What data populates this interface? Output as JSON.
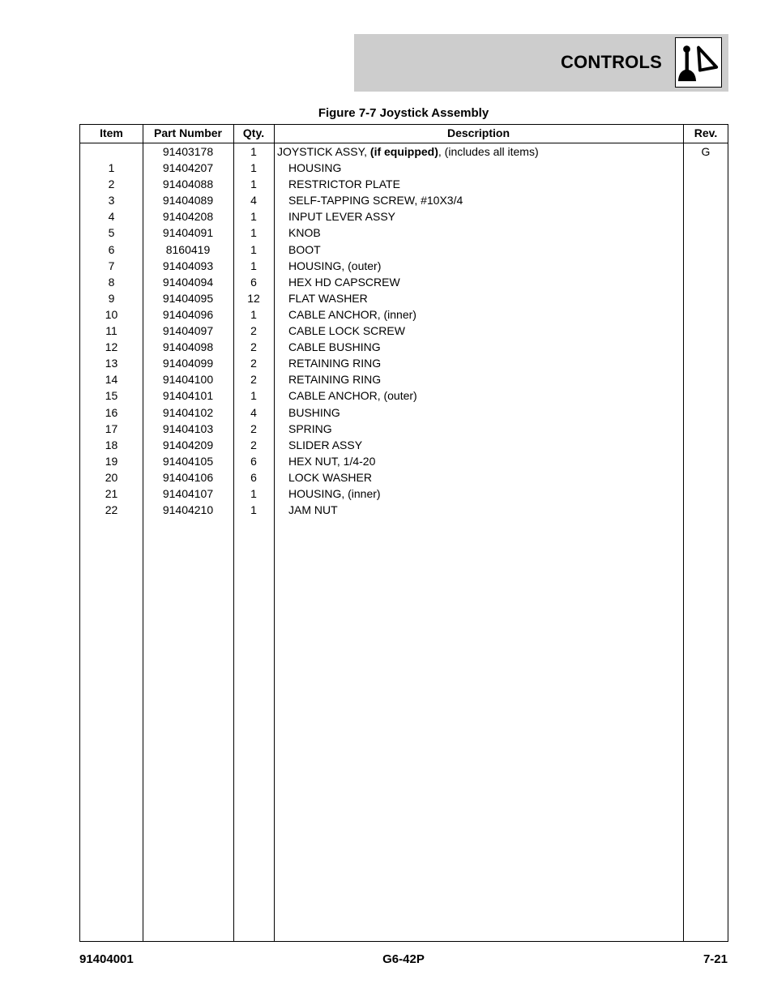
{
  "header": {
    "section_title": "CONTROLS",
    "icon": "joystick-controls-icon",
    "band_color": "#cdcdcd"
  },
  "figure_title": "Figure 7-7 Joystick Assembly",
  "table": {
    "columns": {
      "item": "Item",
      "part_number": "Part Number",
      "qty": "Qty.",
      "description": "Description",
      "rev": "Rev."
    },
    "rows": [
      {
        "item": "",
        "part_number": "91403178",
        "qty": "1",
        "description_prefix": "JOYSTICK ASSY, ",
        "description_bold": "(if equipped)",
        "description_suffix": ", (includes all items)",
        "rev": "G"
      },
      {
        "item": "1",
        "part_number": "91404207",
        "qty": "1",
        "description": "HOUSING",
        "rev": ""
      },
      {
        "item": "2",
        "part_number": "91404088",
        "qty": "1",
        "description": "RESTRICTOR PLATE",
        "rev": ""
      },
      {
        "item": "3",
        "part_number": "91404089",
        "qty": "4",
        "description": "SELF-TAPPING SCREW, #10X3/4",
        "rev": ""
      },
      {
        "item": "4",
        "part_number": "91404208",
        "qty": "1",
        "description": "INPUT LEVER ASSY",
        "rev": ""
      },
      {
        "item": "5",
        "part_number": "91404091",
        "qty": "1",
        "description": "KNOB",
        "rev": ""
      },
      {
        "item": "6",
        "part_number": "8160419",
        "qty": "1",
        "description": "BOOT",
        "rev": ""
      },
      {
        "item": "7",
        "part_number": "91404093",
        "qty": "1",
        "description": "HOUSING, (outer)",
        "rev": ""
      },
      {
        "item": "8",
        "part_number": "91404094",
        "qty": "6",
        "description": "HEX HD CAPSCREW",
        "rev": ""
      },
      {
        "item": "9",
        "part_number": "91404095",
        "qty": "12",
        "description": "FLAT WASHER",
        "rev": ""
      },
      {
        "item": "10",
        "part_number": "91404096",
        "qty": "1",
        "description": "CABLE ANCHOR, (inner)",
        "rev": ""
      },
      {
        "item": "11",
        "part_number": "91404097",
        "qty": "2",
        "description": "CABLE LOCK SCREW",
        "rev": ""
      },
      {
        "item": "12",
        "part_number": "91404098",
        "qty": "2",
        "description": "CABLE BUSHING",
        "rev": ""
      },
      {
        "item": "13",
        "part_number": "91404099",
        "qty": "2",
        "description": "RETAINING RING",
        "rev": ""
      },
      {
        "item": "14",
        "part_number": "91404100",
        "qty": "2",
        "description": "RETAINING RING",
        "rev": ""
      },
      {
        "item": "15",
        "part_number": "91404101",
        "qty": "1",
        "description": "CABLE ANCHOR, (outer)",
        "rev": ""
      },
      {
        "item": "16",
        "part_number": "91404102",
        "qty": "4",
        "description": "BUSHING",
        "rev": ""
      },
      {
        "item": "17",
        "part_number": "91404103",
        "qty": "2",
        "description": "SPRING",
        "rev": ""
      },
      {
        "item": "18",
        "part_number": "91404209",
        "qty": "2",
        "description": "SLIDER ASSY",
        "rev": ""
      },
      {
        "item": "19",
        "part_number": "91404105",
        "qty": "6",
        "description": "HEX NUT, 1/4-20",
        "rev": ""
      },
      {
        "item": "20",
        "part_number": "91404106",
        "qty": "6",
        "description": "LOCK WASHER",
        "rev": ""
      },
      {
        "item": "21",
        "part_number": "91404107",
        "qty": "1",
        "description": "HOUSING, (inner)",
        "rev": ""
      },
      {
        "item": "22",
        "part_number": "91404210",
        "qty": "1",
        "description": "JAM NUT",
        "rev": ""
      }
    ]
  },
  "footer": {
    "left": "91404001",
    "center": "G6-42P",
    "right": "7-21"
  }
}
